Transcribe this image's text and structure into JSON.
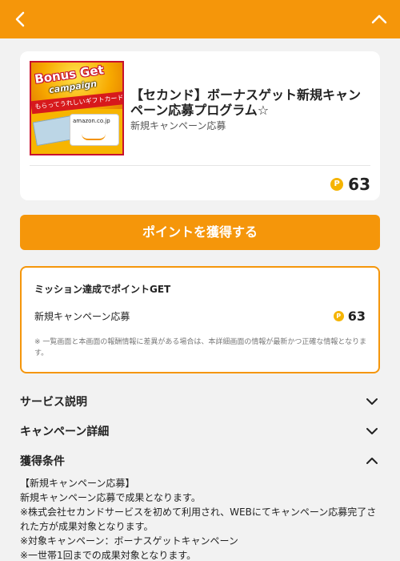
{
  "header": {
    "back_icon": "chevron-left-icon",
    "collapse_icon": "chevron-up-icon"
  },
  "thumbnail": {
    "text_bonus": "Bonus Get",
    "text_campaign": "campaign",
    "text_ribbon": "もらってうれしいギフトカード",
    "text_brand": "amazon.co.jp"
  },
  "offer": {
    "title": "【セカンド】ボーナスゲット新規キャンペーン応募プログラム☆",
    "subtitle": "新規キャンペーン応募",
    "points": "63",
    "coin_icon": "P"
  },
  "cta": {
    "label": "ポイントを獲得する"
  },
  "mission": {
    "title": "ミッション達成でポイントGET",
    "item_label": "新規キャンペーン応募",
    "item_points": "63",
    "note": "※ 一覧画面と本画面の報酬情報に差異がある場合は、本詳細画面の情報が最新かつ正確な情報となります。"
  },
  "sections": {
    "service": "サービス説明",
    "campaign": "キャンペーン詳細",
    "conditions": "獲得条件"
  },
  "conditions_text": {
    "l1": "【新規キャンペーン応募】",
    "l2": "新規キャンペーン応募で成果となります。",
    "l3": "※株式会社セカンドサービスを初めて利用され、WEBにてキャンペーン応募完了さ",
    "l4": "れた方が成果対象となります。",
    "l5": "※対象キャンペーン：ボーナスゲットキャンペーン",
    "l6": "※一世帯1回までの成果対象となります。"
  },
  "colors": {
    "accent": "#f5960a",
    "coin": "#f5b400"
  }
}
